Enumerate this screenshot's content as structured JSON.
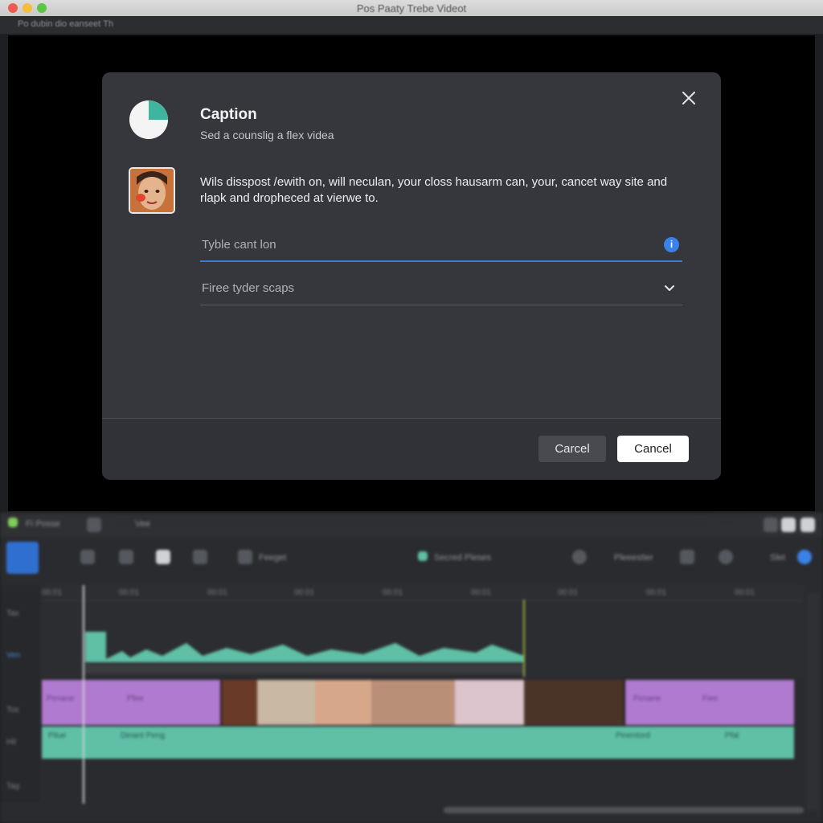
{
  "window": {
    "title": "Pos Paaty Trebe Videot",
    "menubar_label": "Po dubin dio eanseet Th"
  },
  "dialog": {
    "title": "Caption",
    "subtitle": "Sed a counslig a flex videa",
    "body": "Wils disspost /ewith on, will neculan, your closs hausarm can, your, cancet way site and rlapk and dropheced at vierwe to.",
    "caption_input": {
      "placeholder": "Tyble cant lon",
      "value": ""
    },
    "info_icon": "i",
    "select": {
      "value": "Firee tyder sсaps"
    },
    "buttons": {
      "secondary": "Carcel",
      "primary": "Cancel"
    }
  },
  "editor": {
    "toolbar_top": [
      "Fi Posse",
      "Vee"
    ],
    "toolbar_main": [
      "Feeget",
      "Secred Pleses",
      "Pleeestier",
      "Slet"
    ],
    "ruler_ticks": [
      "00:01",
      "00:01",
      "00:01",
      "00:01",
      "00:01",
      "00:01",
      "00:01",
      "00:01",
      "00:01"
    ],
    "track_labels": [
      "Tax",
      "Ven",
      "Tox",
      "Hit",
      "Tag"
    ],
    "caption_clip_labels": [
      "Pilue",
      "Dinant Peng",
      "Pinentord",
      "Pfal"
    ],
    "purple_clip_labels": [
      "Penane",
      "Pfee",
      "Penane",
      "Fiee"
    ]
  },
  "colors": {
    "accent_blue": "#3a7bd5",
    "caption_track": "#5fc0a6",
    "clip_purple": "#b07ad0",
    "dialog_bg": "#35373c"
  }
}
